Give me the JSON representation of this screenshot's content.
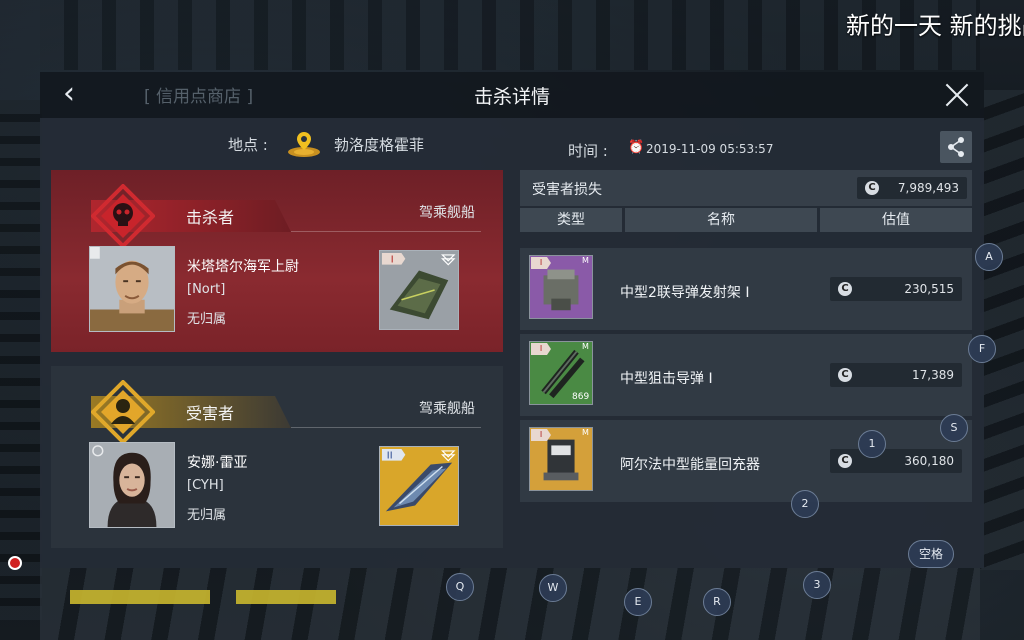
{
  "ticker": {
    "text": "新的一天 新的挑战"
  },
  "header": {
    "ghost_tab": "[ 信用点商店 ]",
    "title": "击杀详情"
  },
  "info": {
    "location_label": "地点 :",
    "location_value": "勃洛度格霍菲",
    "time_label": "时间 :",
    "time_value": "2019-11-09 05:53:57"
  },
  "killer": {
    "role": "击杀者",
    "ship_label": "驾乘舰船",
    "name": "米塔塔尔海军上尉",
    "corp": "[Nort]",
    "alliance": "无归属",
    "ship_tier": "I"
  },
  "victim": {
    "role": "受害者",
    "ship_label": "驾乘舰船",
    "name": "安娜·雷亚",
    "corp": "[CYH]",
    "alliance": "无归属",
    "ship_tier": "II"
  },
  "losses": {
    "title": "受害者损失",
    "total": "7,989,493",
    "columns": [
      "类型",
      "名称",
      "估值"
    ],
    "items": [
      {
        "name": "中型2联导弹发射架 I",
        "value": "230,515",
        "tier": "I",
        "meta": "M",
        "qty": ""
      },
      {
        "name": "中型狙击导弹 I",
        "value": "17,389",
        "tier": "I",
        "meta": "M",
        "qty": "869"
      },
      {
        "name": "阿尔法中型能量回充器",
        "value": "360,180",
        "tier": "I",
        "meta": "M",
        "qty": ""
      }
    ]
  },
  "credit_symbol": "C",
  "hotkeys": {
    "a": "A",
    "f": "F",
    "s": "S",
    "one": "1",
    "two": "2",
    "three": "3",
    "q": "Q",
    "w": "W",
    "e": "E",
    "r": "R",
    "space": "空格"
  },
  "colors": {
    "killer_red": "#8a2a30",
    "victim_gold": "#d9a62a",
    "panel": "#242c36"
  }
}
